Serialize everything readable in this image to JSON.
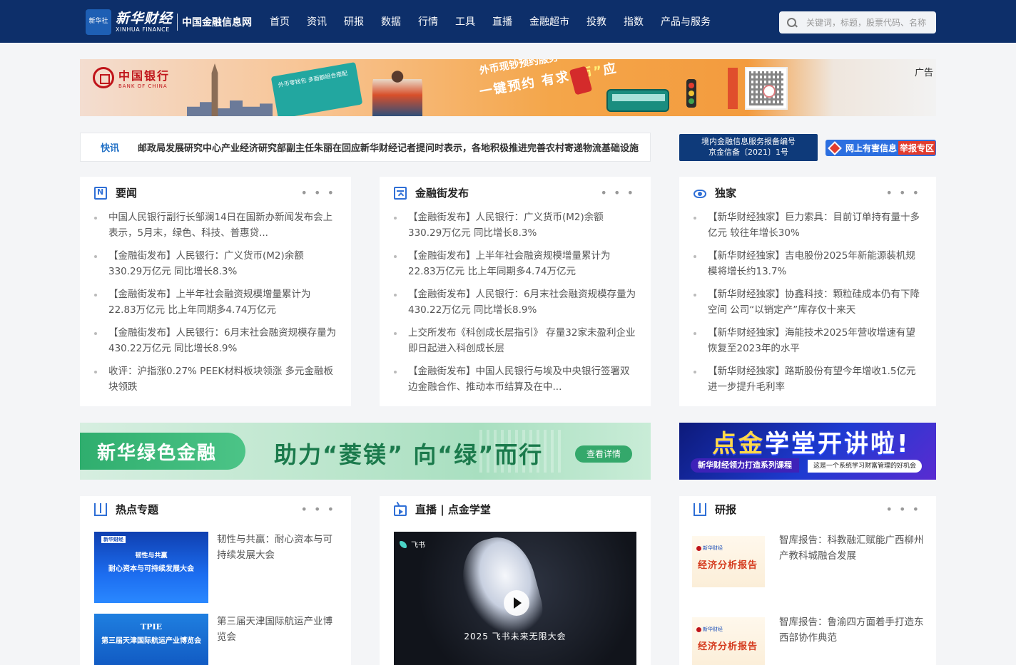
{
  "header": {
    "logo_badge": "新华社",
    "logo_brand_cn": "新华财经",
    "logo_brand_en": "XINHUA FINANCE",
    "site_name": "中国金融信息网",
    "nav": [
      "首页",
      "资讯",
      "研报",
      "数据",
      "行情",
      "工具",
      "直播",
      "金融超市",
      "投教",
      "指数",
      "产品与服务"
    ],
    "search_placeholder": "关键词，标题，股票代码、名称"
  },
  "ad_top": {
    "bank_cn": "中国银行",
    "bank_en": "BANK OF CHINA",
    "card_title": "外币零钱包 多面额组合搭配",
    "slogan1": "外币现钞预约服务",
    "slogan2_a": "一键预约 有求",
    "slogan2_hl": "“币”",
    "slogan2_b": "应",
    "label": "广告"
  },
  "ticker": {
    "tag": "快讯",
    "text": "邮政局发展研究中心产业经济研究部副主任朱丽在回应新华财经记者提问时表示，各地积极推进完善农村寄递物流基础设施"
  },
  "license": {
    "line1": "境内金融信息服务报备编号",
    "line2": "京金信备〔2021〕1号"
  },
  "report_zone": {
    "text": "网上有害信息",
    "highlight": "举报专区"
  },
  "cards": {
    "news": {
      "title": "要闻",
      "items": [
        "中国人民银行副行长邹澜14日在国新办新闻发布会上表示，5月末，绿色、科技、普惠贷...",
        "【金融街发布】人民银行：广义货币(M2)余额330.29万亿元 同比增长8.3%",
        "【金融街发布】上半年社会融资规模增量累计为22.83万亿元 比上年同期多4.74万亿元",
        "【金融街发布】人民银行：6月末社会融资规模存量为430.22万亿元 同比增长8.9%",
        "收评：沪指涨0.27% PEEK材料板块领涨 多元金融板块领跌"
      ]
    },
    "jinrongjie": {
      "title": "金融街发布",
      "items": [
        "【金融街发布】人民银行：广义货币(M2)余额330.29万亿元 同比增长8.3%",
        "【金融街发布】上半年社会融资规模增量累计为22.83万亿元 比上年同期多4.74万亿元",
        "【金融街发布】人民银行：6月末社会融资规模存量为430.22万亿元 同比增长8.9%",
        "上交所发布《科创成长层指引》 存量32家未盈利企业即日起进入科创成长层",
        "【金融街发布】中国人民银行与埃及中央银行签署双边金融合作、推动本币结算及在中..."
      ]
    },
    "exclusive": {
      "title": "独家",
      "items": [
        "【新华财经独家】巨力索具：目前订单持有量十多亿元 较往年增长30%",
        "【新华财经独家】吉电股份2025年新能源装机规模将增长约13.7%",
        "【新华财经独家】协鑫科技：颗粒硅成本仍有下降空间 公司“以销定产”库存仅十来天",
        "【新华财经独家】海能技术2025年营收增速有望恢复至2023年的水平",
        "【新华财经独家】路斯股份有望今年增收1.5亿元 进一步提升毛利率"
      ]
    }
  },
  "green_banner": {
    "pill": "新华绿色金融",
    "slogan": "助力“菱镁” 向“绿”而行",
    "button": "查看详情"
  },
  "blue_banner": {
    "title_a": "点金",
    "title_b": "学堂开讲啦!",
    "sub": "新华财经领力打造系列课程",
    "sub2": "这是一个系统学习财富管理的好机会"
  },
  "hot_topics": {
    "title": "热点专题",
    "items": [
      {
        "text": "韧性与共赢：耐心资本与可持续发展大会",
        "thumb_line1": "韧性与共赢",
        "thumb_line2": "耐心资本与可持续发展大会",
        "thumb_mini": "新华财经"
      },
      {
        "text": "第三届天津国际航运产业博览会",
        "thumb_line1": "TPIE",
        "thumb_line2": "第三届天津国际航运产业博览会",
        "thumb_mini": ""
      }
    ]
  },
  "live": {
    "title": "直播 | 点金学堂",
    "video_brand": "飞书",
    "video_caption": "2025 飞书未来无限大会"
  },
  "research": {
    "title": "研报",
    "thumb_logo": "新华财经",
    "thumb_title": "经济分析报告",
    "items": [
      "智库报告：科教融汇赋能广西柳州产教科城融合发展",
      "智库报告：鲁渝四方面着手打造东西部协作典范"
    ]
  },
  "more_symbol": "• • •",
  "colors": {
    "header_bg": "#0d2f6a",
    "accent_blue": "#2f6fd6",
    "ticker_tag": "#1f6fc5",
    "report_red": "#e23c2e",
    "green": "#34a86b"
  }
}
